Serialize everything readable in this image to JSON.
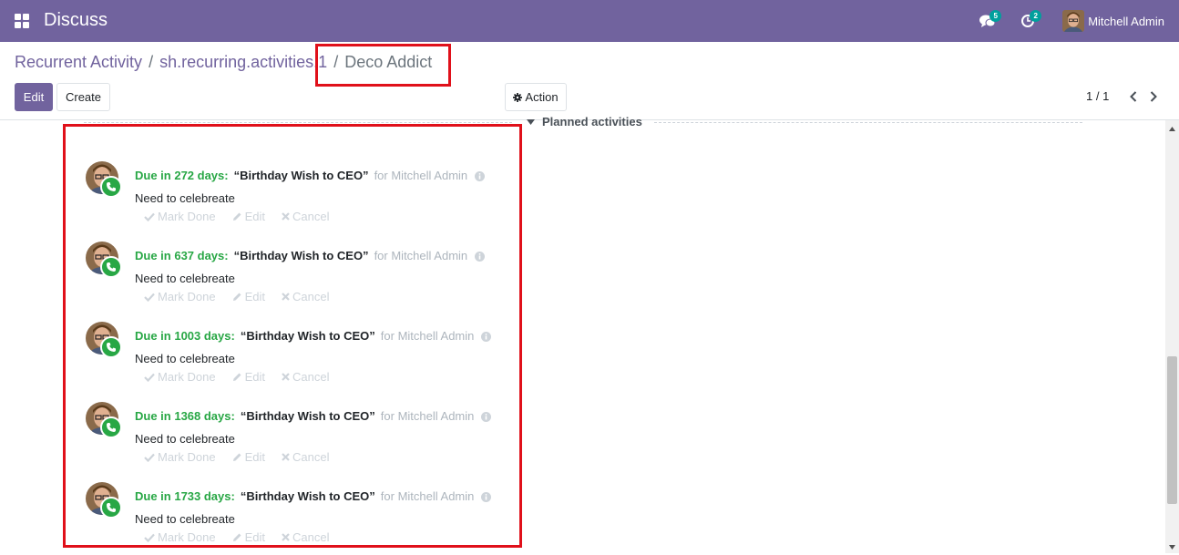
{
  "navbar": {
    "app_title": "Discuss",
    "messages_badge": "5",
    "activities_badge": "2",
    "user_name": "Mitchell Admin",
    "bg_color": "#71639e"
  },
  "breadcrumb": {
    "items": [
      "Recurrent Activity",
      "sh.recurring.activities,1"
    ],
    "separator": "/",
    "current": "Deco Addict"
  },
  "toolbar": {
    "edit_label": "Edit",
    "create_label": "Create",
    "action_label": "Action",
    "pager": "1 / 1"
  },
  "planned_activities_label": "Planned activities",
  "activities": [
    {
      "due": "Due in 272 days:",
      "summary": "“Birthday Wish to CEO”",
      "for": "for Mitchell Admin",
      "note": "Need to celebreate"
    },
    {
      "due": "Due in 637 days:",
      "summary": "“Birthday Wish to CEO”",
      "for": "for Mitchell Admin",
      "note": "Need to celebreate"
    },
    {
      "due": "Due in 1003 days:",
      "summary": "“Birthday Wish to CEO”",
      "for": "for Mitchell Admin",
      "note": "Need to celebreate"
    },
    {
      "due": "Due in 1368 days:",
      "summary": "“Birthday Wish to CEO”",
      "for": "for Mitchell Admin",
      "note": "Need to celebreate"
    },
    {
      "due": "Due in 1733 days:",
      "summary": "“Birthday Wish to CEO”",
      "for": "for Mitchell Admin",
      "note": "Need to celebreate"
    }
  ],
  "activity_actions": {
    "mark_done": "Mark Done",
    "edit": "Edit",
    "cancel": "Cancel"
  },
  "colors": {
    "accent": "#71639e",
    "due_green": "#28a745",
    "highlight_red": "#e0101a"
  }
}
